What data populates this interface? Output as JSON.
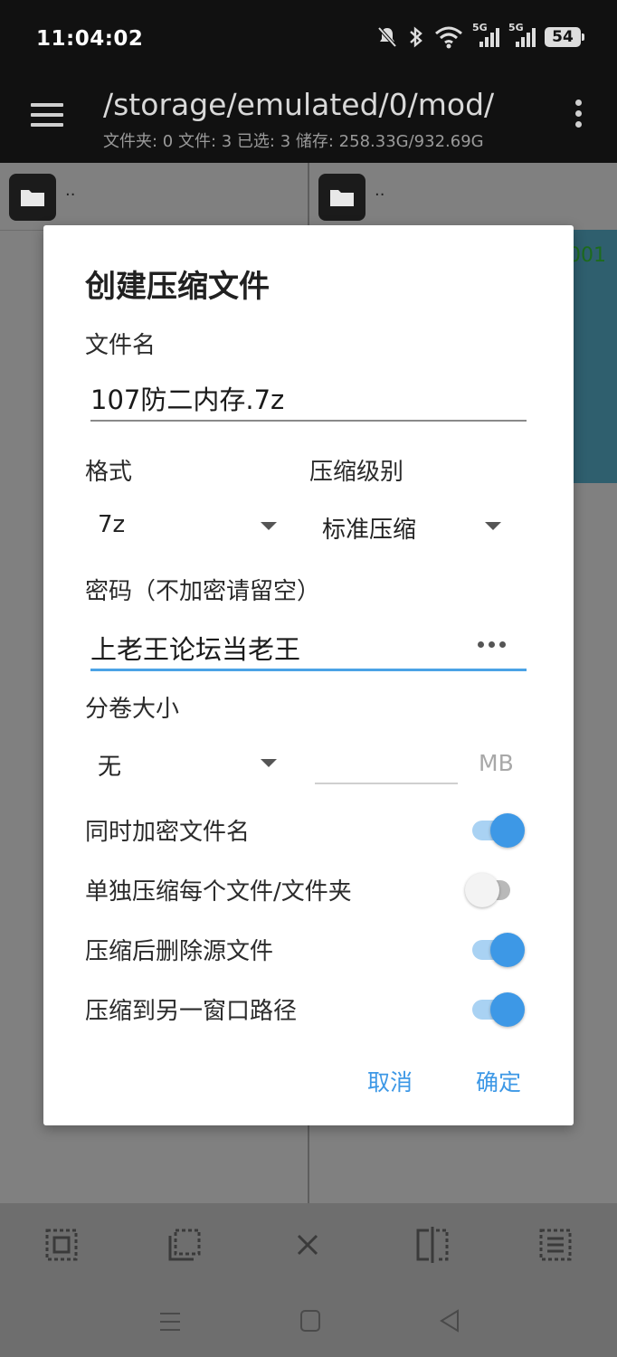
{
  "status": {
    "time": "11:04:02",
    "battery": "54",
    "net1": "5G",
    "net2": "5G"
  },
  "appbar": {
    "path": "/storage/emulated/0/mod/",
    "info": "文件夹: 0  文件: 3  已选: 3  储存: 258.33G/932.69G"
  },
  "panes": {
    "left_parent": "..",
    "right_parent": "..",
    "right_item_suffix": "001"
  },
  "dialog": {
    "title": "创建压缩文件",
    "filename_label": "文件名",
    "filename_value": "107防二内存.7z",
    "format_label": "格式",
    "format_value": "7z",
    "level_label": "压缩级别",
    "level_value": "标准压缩",
    "password_label": "密码（不加密请留空）",
    "password_value": "上老王论坛当老王",
    "split_label": "分卷大小",
    "split_value": "无",
    "split_size_value": "",
    "split_unit": "MB",
    "options": [
      {
        "label": "同时加密文件名",
        "on": true
      },
      {
        "label": "单独压缩每个文件/文件夹",
        "on": false
      },
      {
        "label": "压缩后删除源文件",
        "on": true
      },
      {
        "label": "压缩到另一窗口路径",
        "on": true
      }
    ],
    "cancel": "取消",
    "confirm": "确定"
  },
  "colors": {
    "accent": "#3d98e6",
    "accent_light": "#a9d2f3",
    "scrim_bg": "#7a7a7a"
  }
}
